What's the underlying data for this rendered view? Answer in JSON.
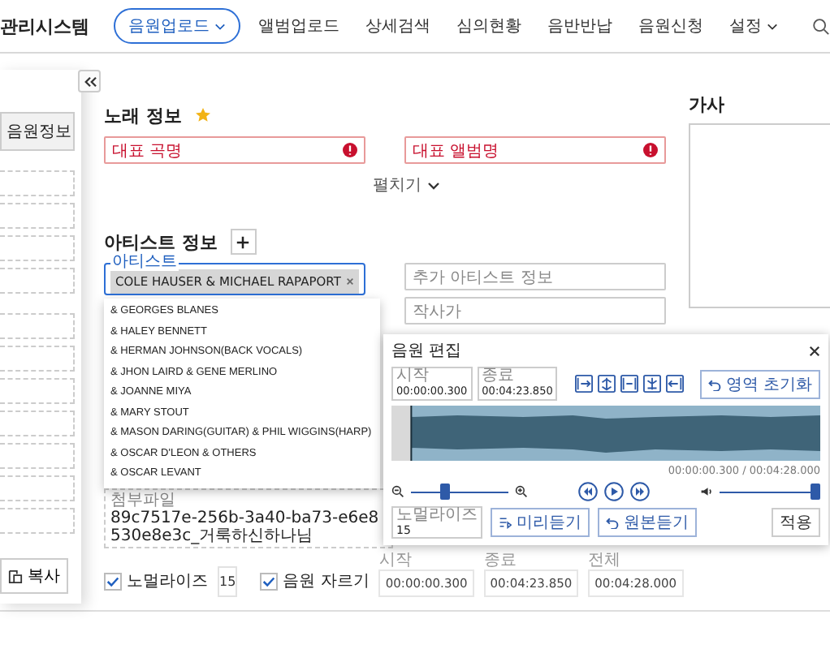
{
  "header": {
    "title": "관리시스템",
    "nav": [
      {
        "label": "음원업로드",
        "selected": true,
        "has_menu": true
      },
      {
        "label": "앨범업로드",
        "selected": false,
        "has_menu": false
      },
      {
        "label": "상세검색",
        "selected": false,
        "has_menu": false
      },
      {
        "label": "심의현황",
        "selected": false,
        "has_menu": false
      },
      {
        "label": "음반반납",
        "selected": false,
        "has_menu": false
      },
      {
        "label": "음원신청",
        "selected": false,
        "has_menu": false
      },
      {
        "label": "설정",
        "selected": false,
        "has_menu": true
      }
    ]
  },
  "sidebar": {
    "tab": "음원정보",
    "copy_button": "복사"
  },
  "song_info": {
    "title": "노래 정보",
    "title_field": {
      "placeholder": "대표 곡명",
      "error": true
    },
    "album_field": {
      "placeholder": "대표 앨범명",
      "error": true
    },
    "expand": "펼치기"
  },
  "artist_info": {
    "title": "아티스트 정보",
    "artist_field": {
      "label": "아티스트",
      "chips": [
        "COLE HAUSER & MICHAEL RAPAPORT"
      ]
    },
    "suggestions": [
      "& GEORGES BLANES",
      "& HALEY BENNETT",
      "& HERMAN JOHNSON(BACK VOCALS)",
      "& JHON LAIRD & GENE MERLINO",
      "& JOANNE MIYA",
      "& MARY STOUT",
      "& MASON DARING(GUITAR) & PHIL WIGGINS(HARP)",
      "& OSCAR D'LEON & OTHERS",
      "& OSCAR LEVANT"
    ],
    "extra_field": {
      "placeholder": "추가 아티스트 정보"
    },
    "lyricist_field": {
      "placeholder": "작사가"
    }
  },
  "attachment": {
    "label": "첨부파일",
    "value": "89c7517e-256b-3a40-ba73-e6e8530e8e3c_거룩하신하나님"
  },
  "options": {
    "normalize": {
      "label": "노멀라이즈",
      "checked": true,
      "value": "15"
    },
    "trim": {
      "label": "음원 자르기",
      "checked": true
    },
    "times": [
      {
        "label": "시작",
        "value": "00:00:00.300"
      },
      {
        "label": "종료",
        "value": "00:04:23.850"
      },
      {
        "label": "전체",
        "value": "00:04:28.000"
      }
    ]
  },
  "lyrics": {
    "title": "가사"
  },
  "editor": {
    "title": "음원 편집",
    "times": [
      {
        "label": "시작",
        "value": "00:00:00.300"
      },
      {
        "label": "종료",
        "value": "00:04:23.850"
      }
    ],
    "reset_button": "영역 초기화",
    "position": "00:00:00.300 / 00:04:28.000",
    "zoom": {
      "level": 0.35
    },
    "volume": {
      "level": 1
    },
    "normalize": {
      "label": "노멀라이즈",
      "value": "15"
    },
    "preview_button": "미리듣기",
    "original_button": "원본듣기",
    "apply_button": "적용"
  }
}
